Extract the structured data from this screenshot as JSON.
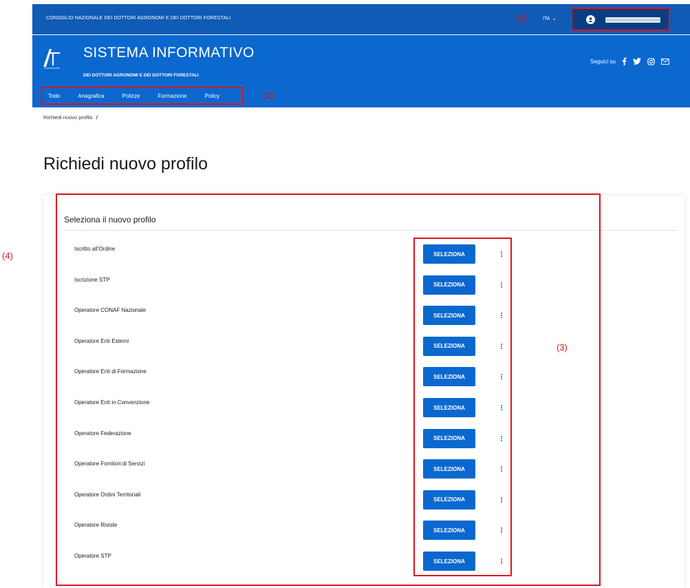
{
  "topbar": {
    "org_name": "CONSIGLIO NAZIONALE DEI DOTTORI AGRONOMI E DEI DOTTORI FORESTALI",
    "language": "ITA",
    "user_icon": "user-icon"
  },
  "header": {
    "title": "SISTEMA INFORMATIVO",
    "subtitle": "DEI DOTTORI AGRONOMI E DEI DOTTORI FORESTALI",
    "social_label": "Seguici su",
    "social_icons": [
      "facebook-icon",
      "twitter-icon",
      "instagram-icon",
      "mail-icon"
    ]
  },
  "nav": {
    "items": [
      "Todo",
      "Anagrafica",
      "Polizze",
      "Formazione",
      "Policy"
    ]
  },
  "breadcrumb": {
    "item": "Richiedi nuovo profilo",
    "separator": "/"
  },
  "page": {
    "title": "Richiedi nuovo profilo"
  },
  "card": {
    "title": "Seleziona il nuovo profilo",
    "button_label": "SELEZIONA",
    "profiles": [
      "Iscritto all'Ordine",
      "Iscrizione STP",
      "Operatore CONAF Nazionale",
      "Operatore Enti Esterni",
      "Operatore Enti di Formazione",
      "Operatore Enti in Convenzione",
      "Operatore Federazione",
      "Operatore Fornitori di Servizi",
      "Operatore Ordini Territoriali",
      "Operatore Riviste",
      "Operatore STP"
    ]
  },
  "annotations": [
    "(1)",
    "(2)",
    "(3)",
    "(4)"
  ],
  "colors": {
    "topbar": "#0f5bb5",
    "header": "#0a68cf",
    "button": "#0a68cf",
    "annotation": "#e0121b"
  }
}
